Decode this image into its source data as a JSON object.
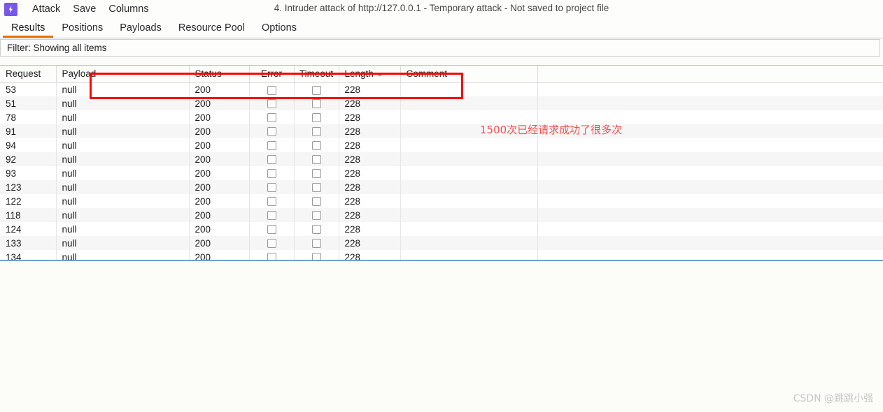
{
  "window": {
    "title": "4. Intruder attack of http://127.0.0.1 - Temporary attack - Not saved to project file",
    "logo_icon": "burp-lightning-icon"
  },
  "menu": {
    "items": [
      {
        "label": "Attack"
      },
      {
        "label": "Save"
      },
      {
        "label": "Columns"
      }
    ]
  },
  "tabs": [
    {
      "label": "Results",
      "active": true
    },
    {
      "label": "Positions",
      "active": false
    },
    {
      "label": "Payloads",
      "active": false
    },
    {
      "label": "Resource Pool",
      "active": false
    },
    {
      "label": "Options",
      "active": false
    }
  ],
  "filter": {
    "label": "Filter: Showing all items"
  },
  "table": {
    "columns": [
      {
        "key": "request",
        "label": "Request",
        "align": "left"
      },
      {
        "key": "payload",
        "label": "Payload",
        "align": "left"
      },
      {
        "key": "status",
        "label": "Status",
        "align": "left"
      },
      {
        "key": "error",
        "label": "Error",
        "align": "center"
      },
      {
        "key": "timeout",
        "label": "Timeout",
        "align": "center"
      },
      {
        "key": "length",
        "label": "Length",
        "align": "left",
        "sort": "asc"
      },
      {
        "key": "comment",
        "label": "Comment",
        "align": "left"
      },
      {
        "key": "spacer",
        "label": "",
        "align": "left"
      }
    ],
    "rows": [
      {
        "request": "53",
        "payload": "null",
        "status": "200",
        "error": false,
        "timeout": false,
        "length": "228",
        "comment": ""
      },
      {
        "request": "51",
        "payload": "null",
        "status": "200",
        "error": false,
        "timeout": false,
        "length": "228",
        "comment": ""
      },
      {
        "request": "78",
        "payload": "null",
        "status": "200",
        "error": false,
        "timeout": false,
        "length": "228",
        "comment": ""
      },
      {
        "request": "91",
        "payload": "null",
        "status": "200",
        "error": false,
        "timeout": false,
        "length": "228",
        "comment": ""
      },
      {
        "request": "94",
        "payload": "null",
        "status": "200",
        "error": false,
        "timeout": false,
        "length": "228",
        "comment": ""
      },
      {
        "request": "92",
        "payload": "null",
        "status": "200",
        "error": false,
        "timeout": false,
        "length": "228",
        "comment": ""
      },
      {
        "request": "93",
        "payload": "null",
        "status": "200",
        "error": false,
        "timeout": false,
        "length": "228",
        "comment": ""
      },
      {
        "request": "123",
        "payload": "null",
        "status": "200",
        "error": false,
        "timeout": false,
        "length": "228",
        "comment": ""
      },
      {
        "request": "122",
        "payload": "null",
        "status": "200",
        "error": false,
        "timeout": false,
        "length": "228",
        "comment": ""
      },
      {
        "request": "118",
        "payload": "null",
        "status": "200",
        "error": false,
        "timeout": false,
        "length": "228",
        "comment": ""
      },
      {
        "request": "124",
        "payload": "null",
        "status": "200",
        "error": false,
        "timeout": false,
        "length": "228",
        "comment": ""
      },
      {
        "request": "133",
        "payload": "null",
        "status": "200",
        "error": false,
        "timeout": false,
        "length": "228",
        "comment": ""
      },
      {
        "request": "134",
        "payload": "null",
        "status": "200",
        "error": false,
        "timeout": false,
        "length": "228",
        "comment": ""
      }
    ]
  },
  "annotations": {
    "highlight_rect": {
      "color": "#fb0606"
    },
    "note_text": "1500次已经请求成功了很多次",
    "note_color": "#f2504f"
  },
  "watermark": {
    "text": "CSDN @跳跳小强"
  },
  "colors": {
    "accent_tab": "#e8730a",
    "logo_bg": "#7759e8",
    "table_border": "#6f9fd0"
  }
}
